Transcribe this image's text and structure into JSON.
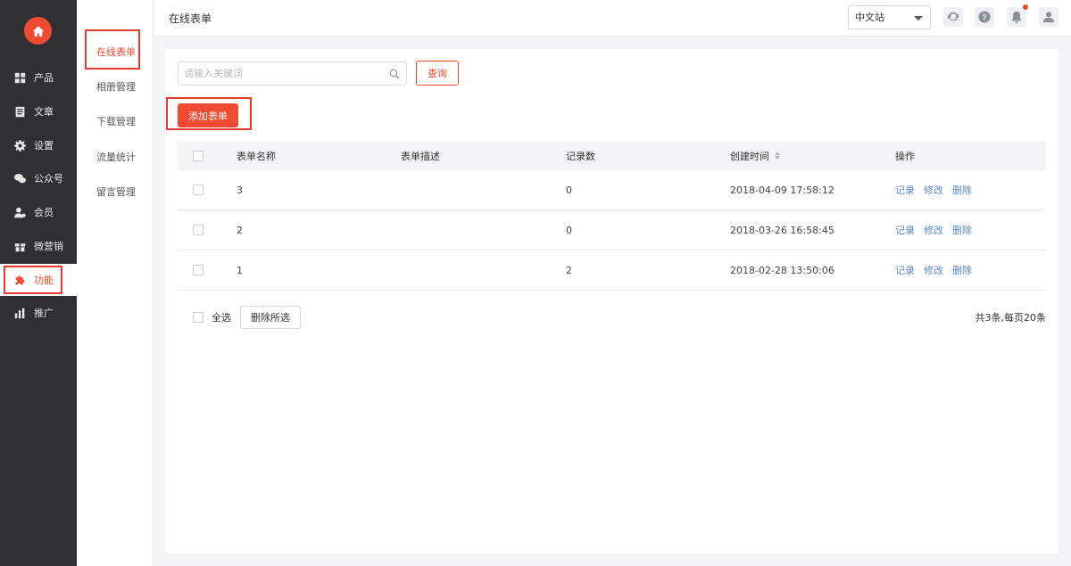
{
  "sidebar": {
    "items": [
      {
        "label": "产品",
        "icon": "grid-icon"
      },
      {
        "label": "文章",
        "icon": "document-icon"
      },
      {
        "label": "设置",
        "icon": "gear-icon"
      },
      {
        "label": "公众号",
        "icon": "wechat-icon"
      },
      {
        "label": "会员",
        "icon": "member-icon"
      },
      {
        "label": "微营销",
        "icon": "gift-icon"
      },
      {
        "label": "功能",
        "icon": "puzzle-icon"
      },
      {
        "label": "推广",
        "icon": "bar-chart-icon"
      }
    ],
    "active": "功能"
  },
  "subnav": {
    "items": [
      "在线表单",
      "相册管理",
      "下载管理",
      "流量统计",
      "留言管理"
    ],
    "active": "在线表单"
  },
  "header": {
    "title": "在线表单",
    "language": "中文站",
    "notification_dot": true
  },
  "search": {
    "placeholder": "请输入关键词",
    "button_label": "查询"
  },
  "add_button_label": "添加表单",
  "table": {
    "columns": [
      "表单名称",
      "表单描述",
      "记录数",
      "创建时间",
      "操作"
    ],
    "rows": [
      {
        "name": "3",
        "description": "",
        "records": "0",
        "created": "2018-04-09 17:58:12"
      },
      {
        "name": "2",
        "description": "",
        "records": "0",
        "created": "2018-03-26 16:58:45"
      },
      {
        "name": "1",
        "description": "",
        "records": "2",
        "created": "2018-02-28 13:50:06"
      }
    ],
    "actions": [
      "记录",
      "修改",
      "删除"
    ]
  },
  "footer": {
    "select_all_label": "全选",
    "delete_selected_label": "删除所选",
    "total": "共3条,每页20条"
  },
  "colors": {
    "accent": "#f04a31",
    "sidebar_bg": "#2f3035",
    "link": "#5b87c6",
    "highlight_box": "#e83a33"
  }
}
